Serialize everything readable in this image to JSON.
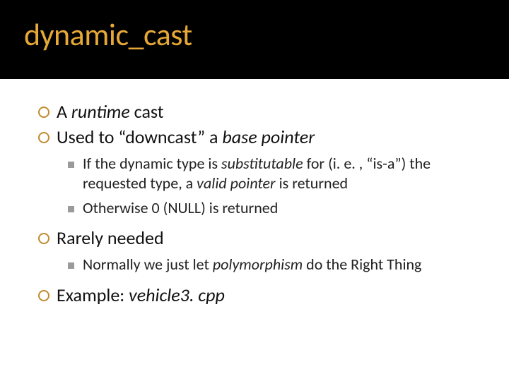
{
  "title": "dynamic_cast",
  "items": [
    {
      "level": 1,
      "html": "A <em>runtime</em> cast"
    },
    {
      "level": 1,
      "html": "Used to “downcast” a <em>base pointer</em>"
    },
    {
      "level": 2,
      "html": "If the dynamic type is <em>substitutable</em> for (i. e. , “is-a”) the requested type, a <em>valid pointer</em> is returned"
    },
    {
      "level": 2,
      "html": "Otherwise 0 (NULL) is returned"
    },
    {
      "level": 1,
      "html": "Rarely needed"
    },
    {
      "level": 2,
      "html": "Normally we just let <em>polymorphism</em> do the Right Thing"
    },
    {
      "level": 1,
      "html": "Example: <em>vehicle3. cpp</em>"
    }
  ]
}
